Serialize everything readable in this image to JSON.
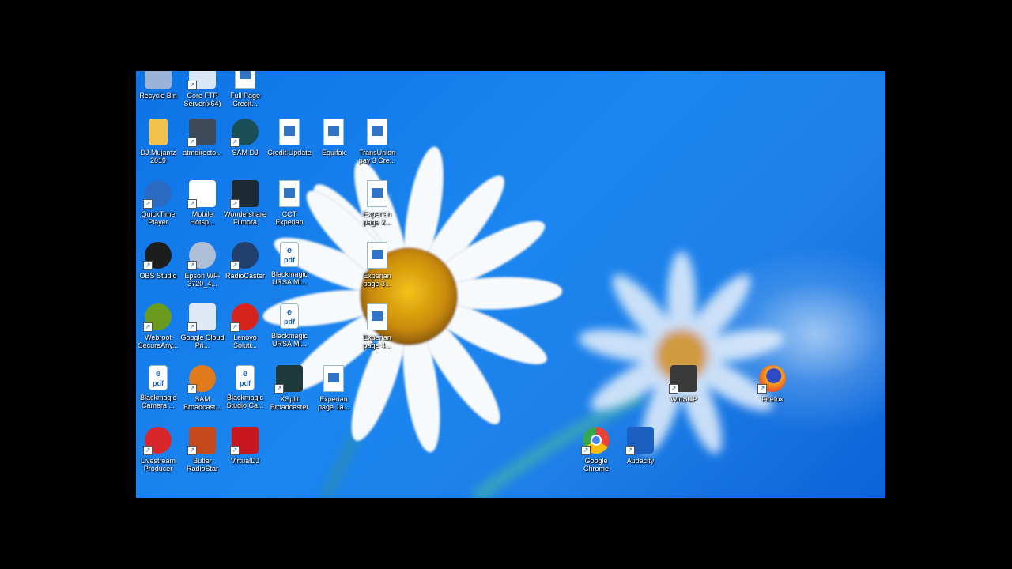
{
  "desktop": {
    "icons": [
      {
        "label": "Recycle Bin",
        "glyph": "recycle-bin-icon",
        "color": "#9bb3d6"
      },
      {
        "label": "Core FTP Server(x64)",
        "glyph": "ftp-server-icon",
        "color": "#d8e6f5"
      },
      {
        "label": "Full Page Credit...",
        "glyph": "document-icon",
        "color": "#ffffff"
      },
      {
        "label": "DJ Mujamz 2019",
        "glyph": "folder-icon",
        "color": "#f2c24a"
      },
      {
        "label": "atmdirecto...",
        "glyph": "monitor-icon",
        "color": "#3c4a5a"
      },
      {
        "label": "SAM DJ",
        "glyph": "sam-dj-icon",
        "color": "#1a4f5a"
      },
      {
        "label": "Credit Update",
        "glyph": "document-icon",
        "color": "#ffffff"
      },
      {
        "label": "Equifax",
        "glyph": "document-icon",
        "color": "#ffffff"
      },
      {
        "label": "TransUnion pay 3 Cre...",
        "glyph": "document-icon",
        "color": "#ffffff"
      },
      {
        "label": "QuickTime Player",
        "glyph": "quicktime-icon",
        "color": "#2b6bc4"
      },
      {
        "label": "Mobile Hotsp...",
        "glyph": "wifi-hotspot-icon",
        "color": "#ffffff"
      },
      {
        "label": "Wondershare Filmora",
        "glyph": "filmora-icon",
        "color": "#1c2a33"
      },
      {
        "label": "CCT Experian",
        "glyph": "document-icon",
        "color": "#ffffff"
      },
      {
        "label": "Experian page 2...",
        "glyph": "document-icon",
        "color": "#ffffff"
      },
      {
        "label": "OBS Studio",
        "glyph": "obs-icon",
        "color": "#1d1d1d"
      },
      {
        "label": "Epson WF-3720_4...",
        "glyph": "printer-icon",
        "color": "#aebfd8"
      },
      {
        "label": "RadioCaster",
        "glyph": "satellite-icon",
        "color": "#22406e"
      },
      {
        "label": "Blackmagic URSA Mi...",
        "glyph": "pdf-icon",
        "color": "#ffffff"
      },
      {
        "label": "Experian page 3...",
        "glyph": "document-icon",
        "color": "#ffffff"
      },
      {
        "label": "Webroot SecureAny...",
        "glyph": "webroot-icon",
        "color": "#6a9b1f"
      },
      {
        "label": "Google Cloud Pri...",
        "glyph": "cloud-printer-icon",
        "color": "#dfe9f5"
      },
      {
        "label": "Lenovo Soluti...",
        "glyph": "lenovo-icon",
        "color": "#d6241c"
      },
      {
        "label": "Blackmagic URSA Mi...",
        "glyph": "pdf-icon",
        "color": "#ffffff"
      },
      {
        "label": "Experian page 4...",
        "glyph": "document-icon",
        "color": "#ffffff"
      },
      {
        "label": "Blackmagic Camera ...",
        "glyph": "pdf-icon",
        "color": "#ffffff"
      },
      {
        "label": "SAM Broadcast...",
        "glyph": "sam-broadcaster-icon",
        "color": "#e07a1a"
      },
      {
        "label": "Blackmagic Studio Ca...",
        "glyph": "pdf-icon",
        "color": "#ffffff"
      },
      {
        "label": "XSplit Broadcaster",
        "glyph": "xsplit-icon",
        "color": "#1e3a3a"
      },
      {
        "label": "Experian page 1a...",
        "glyph": "document-icon",
        "color": "#ffffff"
      },
      {
        "label": "WinSCP",
        "glyph": "winscp-icon",
        "color": "#3a3a3a"
      },
      {
        "label": "Firefox",
        "glyph": "firefox-icon",
        "color": "#e8552a"
      },
      {
        "label": "Livestream Producer",
        "glyph": "livestream-icon",
        "color": "#d8262a"
      },
      {
        "label": "Butler RadioStar",
        "glyph": "radiostar-icon",
        "color": "#c44a1c"
      },
      {
        "label": "VirtualDJ",
        "glyph": "virtualdj-icon",
        "color": "#c8161e"
      },
      {
        "label": "Google Chrome",
        "glyph": "chrome-icon",
        "color": "#4285f4"
      },
      {
        "label": "Audacity",
        "glyph": "audacity-icon",
        "color": "#1b5fc0"
      }
    ]
  }
}
